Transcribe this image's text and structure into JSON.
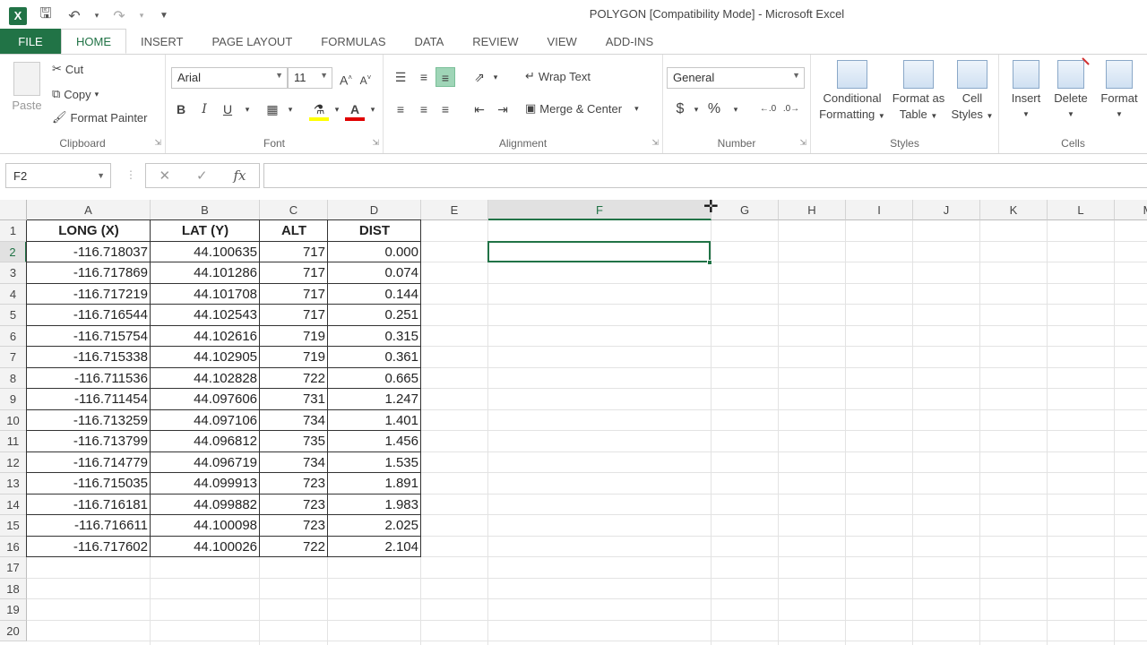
{
  "window": {
    "title": "POLYGON  [Compatibility Mode] - Microsoft Excel",
    "logo": "X"
  },
  "tabs": [
    "FILE",
    "HOME",
    "INSERT",
    "PAGE LAYOUT",
    "FORMULAS",
    "DATA",
    "REVIEW",
    "VIEW",
    "ADD-INS"
  ],
  "active_tab": "HOME",
  "ribbon": {
    "clipboard": {
      "label": "Clipboard",
      "paste": "Paste",
      "cut": "Cut",
      "copy": "Copy",
      "format_painter": "Format Painter"
    },
    "font": {
      "label": "Font",
      "font_name": "Arial",
      "font_size": "11",
      "bold": "B",
      "italic": "I",
      "underline": "U"
    },
    "alignment": {
      "label": "Alignment",
      "wrap_text": "Wrap Text",
      "merge_center": "Merge & Center"
    },
    "number": {
      "label": "Number",
      "format": "General",
      "currency": "$",
      "percent": "%"
    },
    "styles": {
      "label": "Styles",
      "conditional": "Conditional Formatting",
      "conditional_l1": "Conditional",
      "conditional_l2": "Formatting",
      "format_table_l1": "Format as",
      "format_table_l2": "Table",
      "cell_styles_l1": "Cell",
      "cell_styles_l2": "Styles"
    },
    "cells": {
      "label": "Cells",
      "insert": "Insert",
      "delete": "Delete",
      "format": "Format"
    }
  },
  "formula_bar": {
    "name_box": "F2",
    "fx": "fx",
    "formula": ""
  },
  "columns": [
    "A",
    "B",
    "C",
    "D",
    "E",
    "F",
    "G",
    "H",
    "I",
    "J",
    "K",
    "L",
    "M"
  ],
  "selected_column": "F",
  "selected_row": 2,
  "rows": [
    1,
    2,
    3,
    4,
    5,
    6,
    7,
    8,
    9,
    10,
    11,
    12,
    13,
    14,
    15,
    16,
    17,
    18,
    19,
    20
  ],
  "table": {
    "headers": [
      "LONG (X)",
      "LAT (Y)",
      "ALT",
      "DIST"
    ],
    "data": [
      [
        "-116.718037",
        "44.100635",
        "717",
        "0.000"
      ],
      [
        "-116.717869",
        "44.101286",
        "717",
        "0.074"
      ],
      [
        "-116.717219",
        "44.101708",
        "717",
        "0.144"
      ],
      [
        "-116.716544",
        "44.102543",
        "717",
        "0.251"
      ],
      [
        "-116.715754",
        "44.102616",
        "719",
        "0.315"
      ],
      [
        "-116.715338",
        "44.102905",
        "719",
        "0.361"
      ],
      [
        "-116.711536",
        "44.102828",
        "722",
        "0.665"
      ],
      [
        "-116.711454",
        "44.097606",
        "731",
        "1.247"
      ],
      [
        "-116.713259",
        "44.097106",
        "734",
        "1.401"
      ],
      [
        "-116.713799",
        "44.096812",
        "735",
        "1.456"
      ],
      [
        "-116.714779",
        "44.096719",
        "734",
        "1.535"
      ],
      [
        "-116.715035",
        "44.099913",
        "723",
        "1.891"
      ],
      [
        "-116.716181",
        "44.099882",
        "723",
        "1.983"
      ],
      [
        "-116.716611",
        "44.100098",
        "723",
        "2.025"
      ],
      [
        "-116.717602",
        "44.100026",
        "722",
        "2.104"
      ]
    ]
  },
  "colors": {
    "excel_green": "#217346",
    "table_border": "#333333",
    "grid_line": "#e3e3e3"
  }
}
